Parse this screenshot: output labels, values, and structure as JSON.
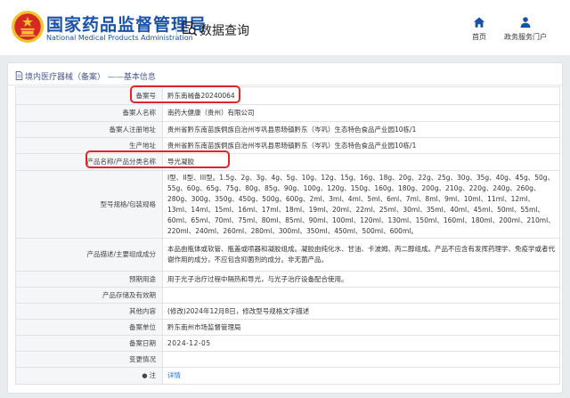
{
  "header": {
    "brand_cn": "国家药品监督管理局",
    "brand_en": "National Medical Products Administration",
    "query_label": "数据查询",
    "nav": [
      {
        "label": "首页",
        "icon": "home-icon"
      },
      {
        "label": "政务服务门户",
        "icon": "user-icon"
      }
    ]
  },
  "breadcrumb": {
    "text": "境内医疗器械（备案） ——基本信息"
  },
  "colors": {
    "brand_blue": "#1a52a6",
    "emblem_red": "#d42a22",
    "emblem_gold": "#f2c230",
    "highlight_red": "#e0262b",
    "link_blue": "#2b6cc4"
  },
  "record": {
    "rows": [
      {
        "label": "备案号",
        "value": "黔东南械备20240064"
      },
      {
        "label": "备案人名称",
        "value": "南药大健康（贵州）有限公司"
      },
      {
        "label": "备案人注册地址",
        "value": "贵州省黔东南苗族侗族自治州岑巩县思旸镇黔东（岑巩）生态特色食品产业园10栋/1"
      },
      {
        "label": "生产地址",
        "value": "贵州省黔东南苗族侗族自治州岑巩县思旸镇黔东（岑巩）生态特色食品产业园10栋/1"
      },
      {
        "label": "产品名称/产品分类名称",
        "value": "导光凝胶"
      },
      {
        "label": "型号规格/包装规格",
        "value": "I型、II型、III型。1.5g、2g、3g、4g、5g、10g、12g、15g、16g、18g、20g、22g、25g、30g、35g、40g、45g、50g、55g、60g、65g、75g、80g、85g、90g、100g、120g、150g、160g、180g、200g、210g、220g、240g、260g、280g、300g、350g、450g、500g、600g、2ml、3ml、4ml、5ml、6ml、7ml、8ml、9ml、10ml、11ml、12ml、13ml、14ml、15ml、16ml、17ml、18ml、19ml、20ml、22ml、25ml、30ml、35ml、40ml、45ml、50ml、55ml、60ml、65ml、70ml、75ml、80ml、85ml、90ml、100ml、120ml、130ml、150ml、160ml、180ml、200ml、210ml、220ml、240ml、260ml、280ml、300ml、350ml、450ml、500ml、600ml。"
      },
      {
        "label": "产品描述/主要组成成分",
        "value": "本品由瓶体或软管、瓶盖或喷器和凝胶组成。凝胶由纯化水、甘油、卡波姆、丙二醇组成。产品不应含有发挥药理学、免疫学或者代谢作用的成分，不应包含抑菌剂的成分。非无菌产品。"
      },
      {
        "label": "预期用途",
        "value": "用于光子治疗过程中隔热和导光，与光子治疗设备配合使用。"
      },
      {
        "label": "产品存储及有效期",
        "value": ""
      },
      {
        "label": "其他内容",
        "value": "(修改)2024年12月8日，修改型号规格文字描述"
      },
      {
        "label": "备案单位",
        "value": "黔东南州市场监督管理局"
      },
      {
        "label": "备案日期",
        "value": "2024-12-05"
      },
      {
        "label": "变更情况",
        "value": ""
      },
      {
        "label": "注",
        "value": "详情"
      }
    ]
  }
}
